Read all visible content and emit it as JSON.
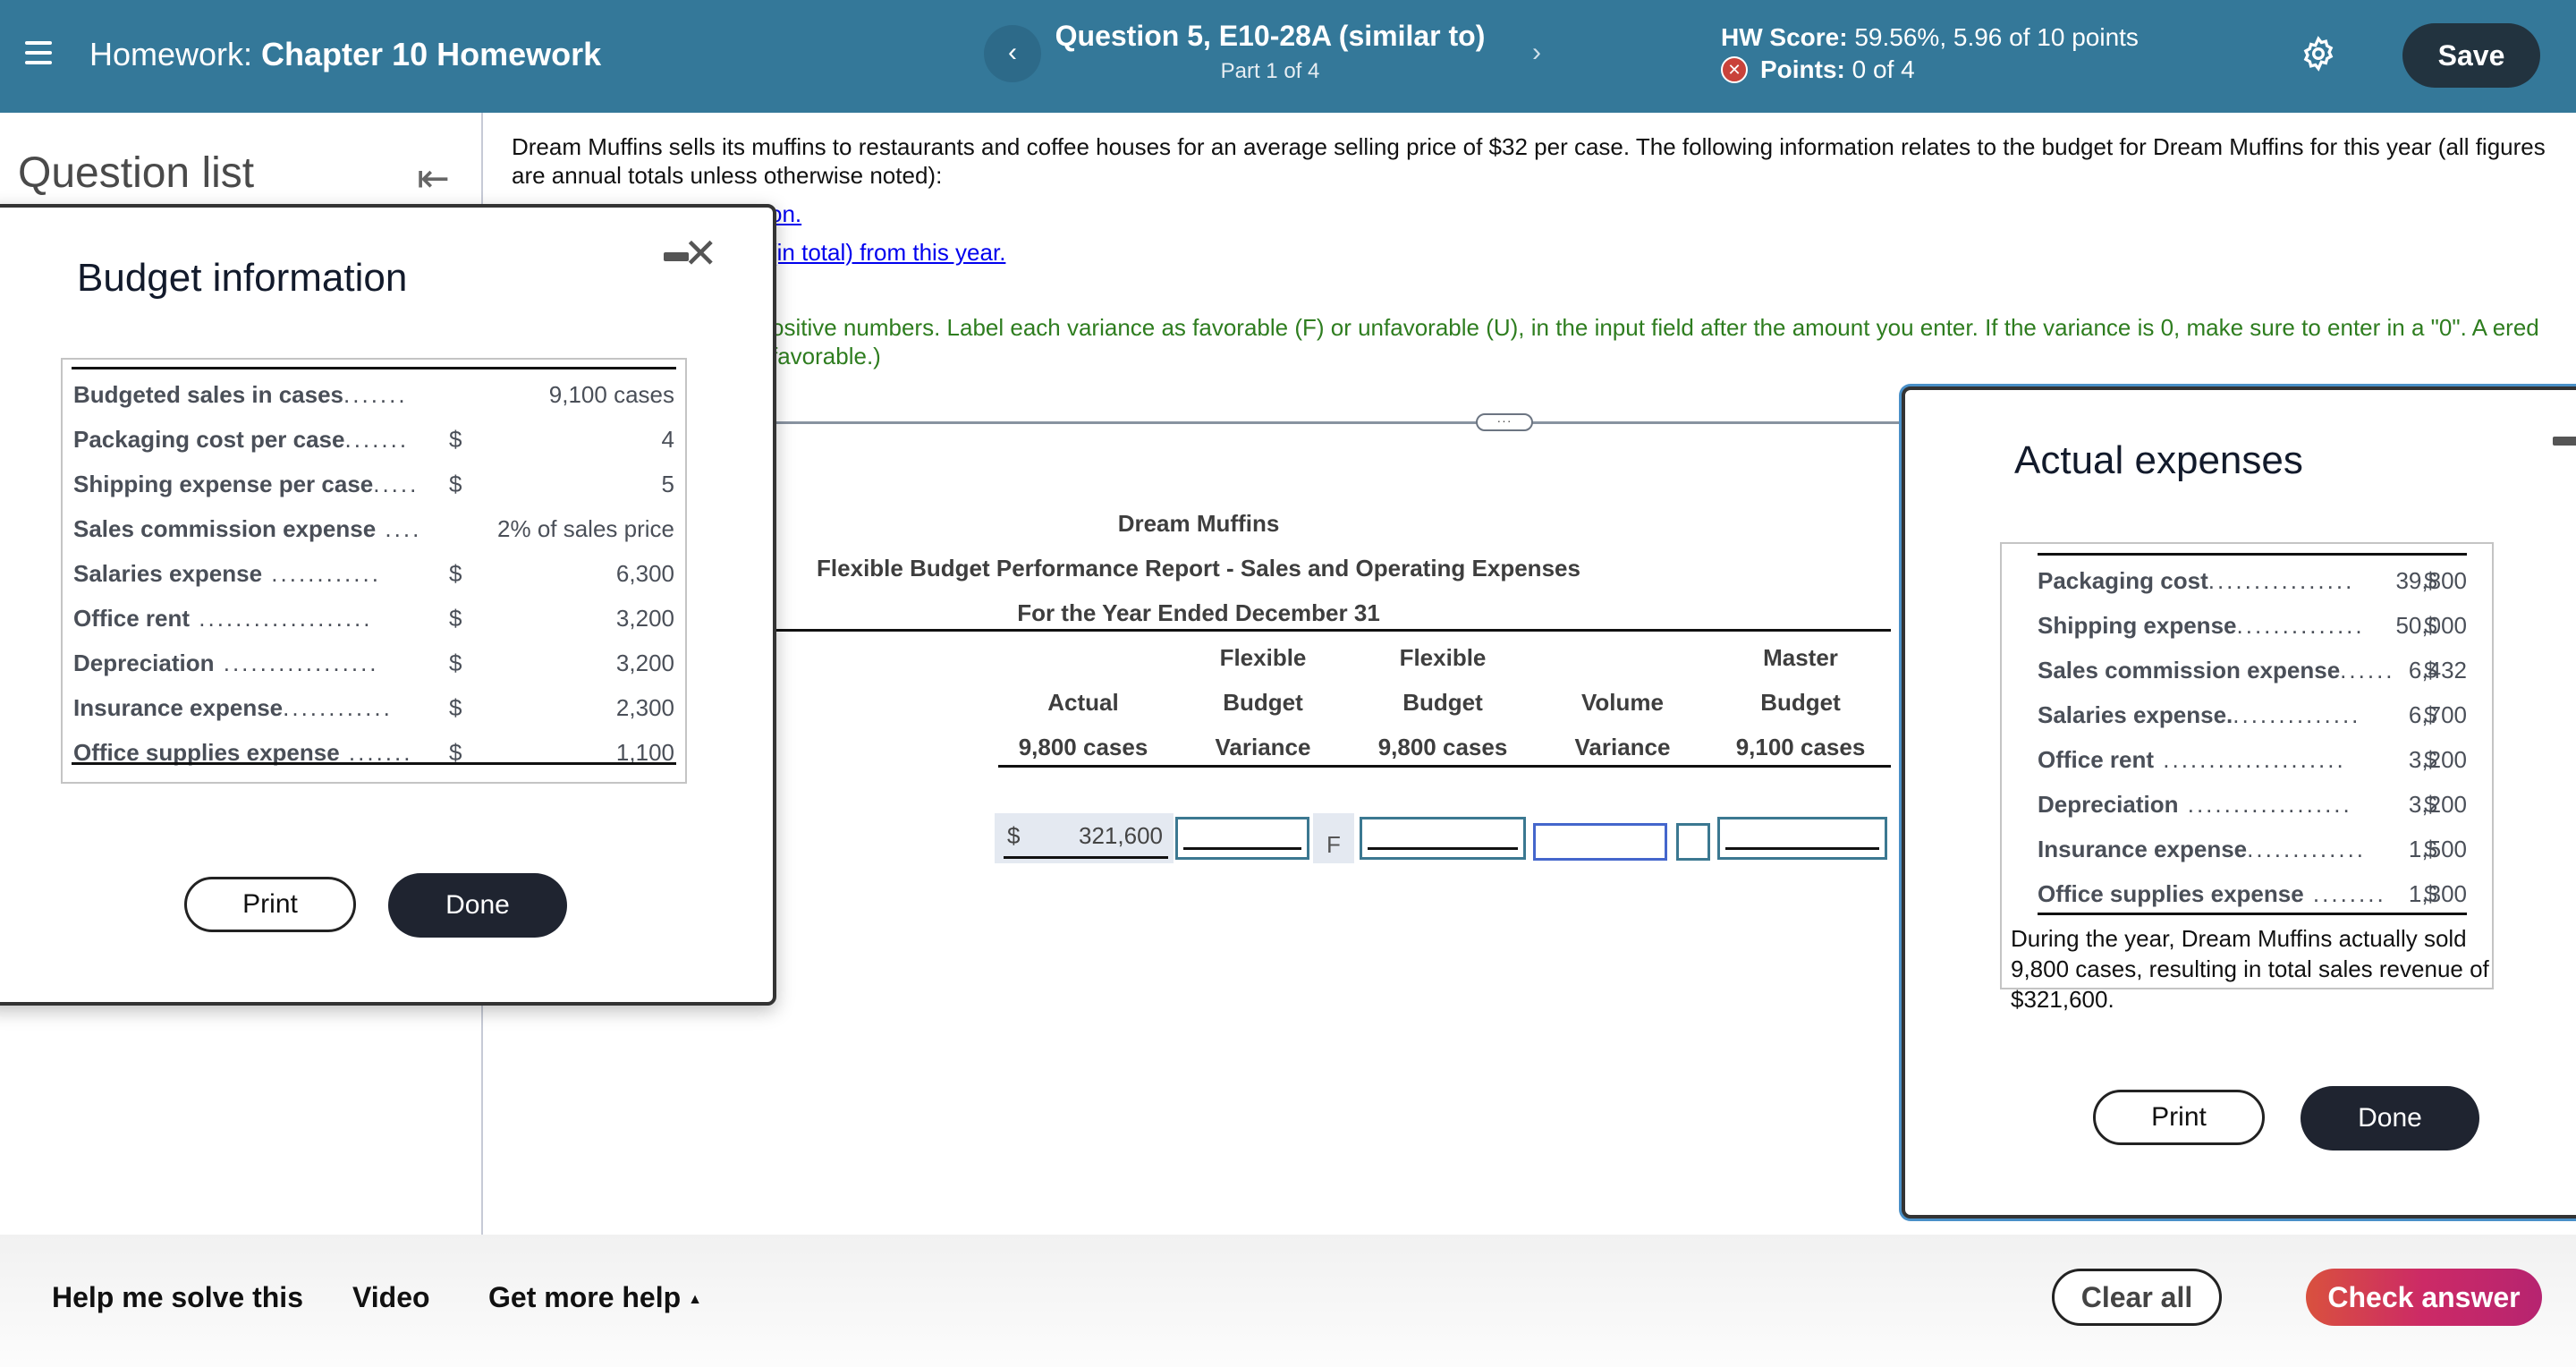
{
  "header": {
    "homework_prefix": "Homework:",
    "homework_name": "Chapter 10 Homework",
    "question_title": "Question 5, E10-28A (similar to)",
    "question_part": "Part 1 of 4",
    "hw_score_label": "HW Score:",
    "hw_score_value": "59.56%, 5.96 of 10 points",
    "points_label": "Points:",
    "points_value": "0 of 4",
    "prev_icon": "‹",
    "next_icon": "›",
    "save_label": "Save"
  },
  "left_panel": {
    "title": "Question list",
    "collapse_icon": "⇤"
  },
  "question": {
    "text": "Dream Muffins sells its muffins to restaurants and coffee houses for an average selling price of $32 per case. The following information relates to the budget for Dream Muffins for this year (all figures are annual totals unless otherwise noted):",
    "link_1_visible": "on.",
    "link_2_visible": "(in total) from this year.",
    "instructions_visible": "ositive numbers. Label each variance as favorable (F) or unfavorable (U), in the input field after the amount you enter. If the variance is 0, make sure to enter in a \"0\". A ered favorable.)",
    "separator_handle": "···"
  },
  "report": {
    "company": "Dream Muffins",
    "name": "Flexible Budget Performance Report - Sales and Operating Expenses",
    "period": "For the Year Ended December 31",
    "columns": [
      {
        "line1": "",
        "line2": "Actual",
        "line3": "9,800 cases"
      },
      {
        "line1": "Flexible",
        "line2": "Budget",
        "line3": "Variance"
      },
      {
        "line1": "Flexible",
        "line2": "Budget",
        "line3": "9,800 cases"
      },
      {
        "line1": "",
        "line2": "Volume",
        "line3": "Variance"
      },
      {
        "line1": "Master",
        "line2": "Budget",
        "line3": "9,100 cases"
      }
    ],
    "row_1": {
      "actual_currency": "$",
      "actual_value": "321,600",
      "flexible_budget_variance": "",
      "flexible_budget_variance_label": "F",
      "flexible_budget": "",
      "volume_variance": "",
      "volume_variance_label": "",
      "master_budget": ""
    }
  },
  "budget_popup": {
    "title": "Budget information",
    "rows": [
      {
        "label": "Budgeted sales in cases",
        "dots": ".......",
        "currency": "",
        "amount": "9,100 cases"
      },
      {
        "label": "Packaging cost per case",
        "dots": ".......",
        "currency": "$",
        "amount": "4"
      },
      {
        "label": "Shipping expense per case",
        "dots": ".....",
        "currency": "$",
        "amount": "5"
      },
      {
        "label": "Sales commission expense",
        "dots": " ....",
        "currency": "",
        "amount": "2% of sales price"
      },
      {
        "label": "Salaries expense",
        "dots": " ............",
        "currency": "$",
        "amount": "6,300"
      },
      {
        "label": "Office rent",
        "dots": " ...................",
        "currency": "$",
        "amount": "3,200"
      },
      {
        "label": "Depreciation",
        "dots": " .................",
        "currency": "$",
        "amount": "3,200"
      },
      {
        "label": "Insurance expense",
        "dots": "............",
        "currency": "$",
        "amount": "2,300"
      },
      {
        "label": "Office supplies expense",
        "dots": " .......",
        "currency": "$",
        "amount": "1,100"
      }
    ],
    "print_label": "Print",
    "done_label": "Done"
  },
  "actual_popup": {
    "title": "Actual expenses",
    "rows": [
      {
        "label": "Packaging cost",
        "dots": "................",
        "currency": "$",
        "amount": "39,800"
      },
      {
        "label": "Shipping expense",
        "dots": "..............",
        "currency": "$",
        "amount": "50,000"
      },
      {
        "label": "Sales commission expense",
        "dots": "......",
        "currency": "$",
        "amount": "6,432"
      },
      {
        "label": "Salaries expense.",
        "dots": "..............",
        "currency": "$",
        "amount": "6,700"
      },
      {
        "label": "Office rent",
        "dots": " ....................",
        "currency": "$",
        "amount": "3,200"
      },
      {
        "label": "Depreciation",
        "dots": " ..................",
        "currency": "$",
        "amount": "3,200"
      },
      {
        "label": "Insurance expense",
        "dots": ".............",
        "currency": "$",
        "amount": "1,500"
      },
      {
        "label": "Office supplies expense",
        "dots": " ........",
        "currency": "$",
        "amount": "1,300"
      }
    ],
    "note": "During the year, Dream Muffins actually sold 9,800 cases, resulting in total sales revenue of $321,600.",
    "print_label": "Print",
    "done_label": "Done"
  },
  "bottom_bar": {
    "help_solve": "Help me solve this",
    "video": "Video",
    "more_help": "Get more help",
    "more_help_icon": "▲",
    "clear_all": "Clear all",
    "check_answer": "Check answer"
  },
  "colors": {
    "header_bg": "#347899",
    "save_bg": "#22333f",
    "link": "#0000ee",
    "instruction_green": "#2e7d1f",
    "check_answer_start": "#d9513e",
    "check_answer_end": "#b62470"
  }
}
